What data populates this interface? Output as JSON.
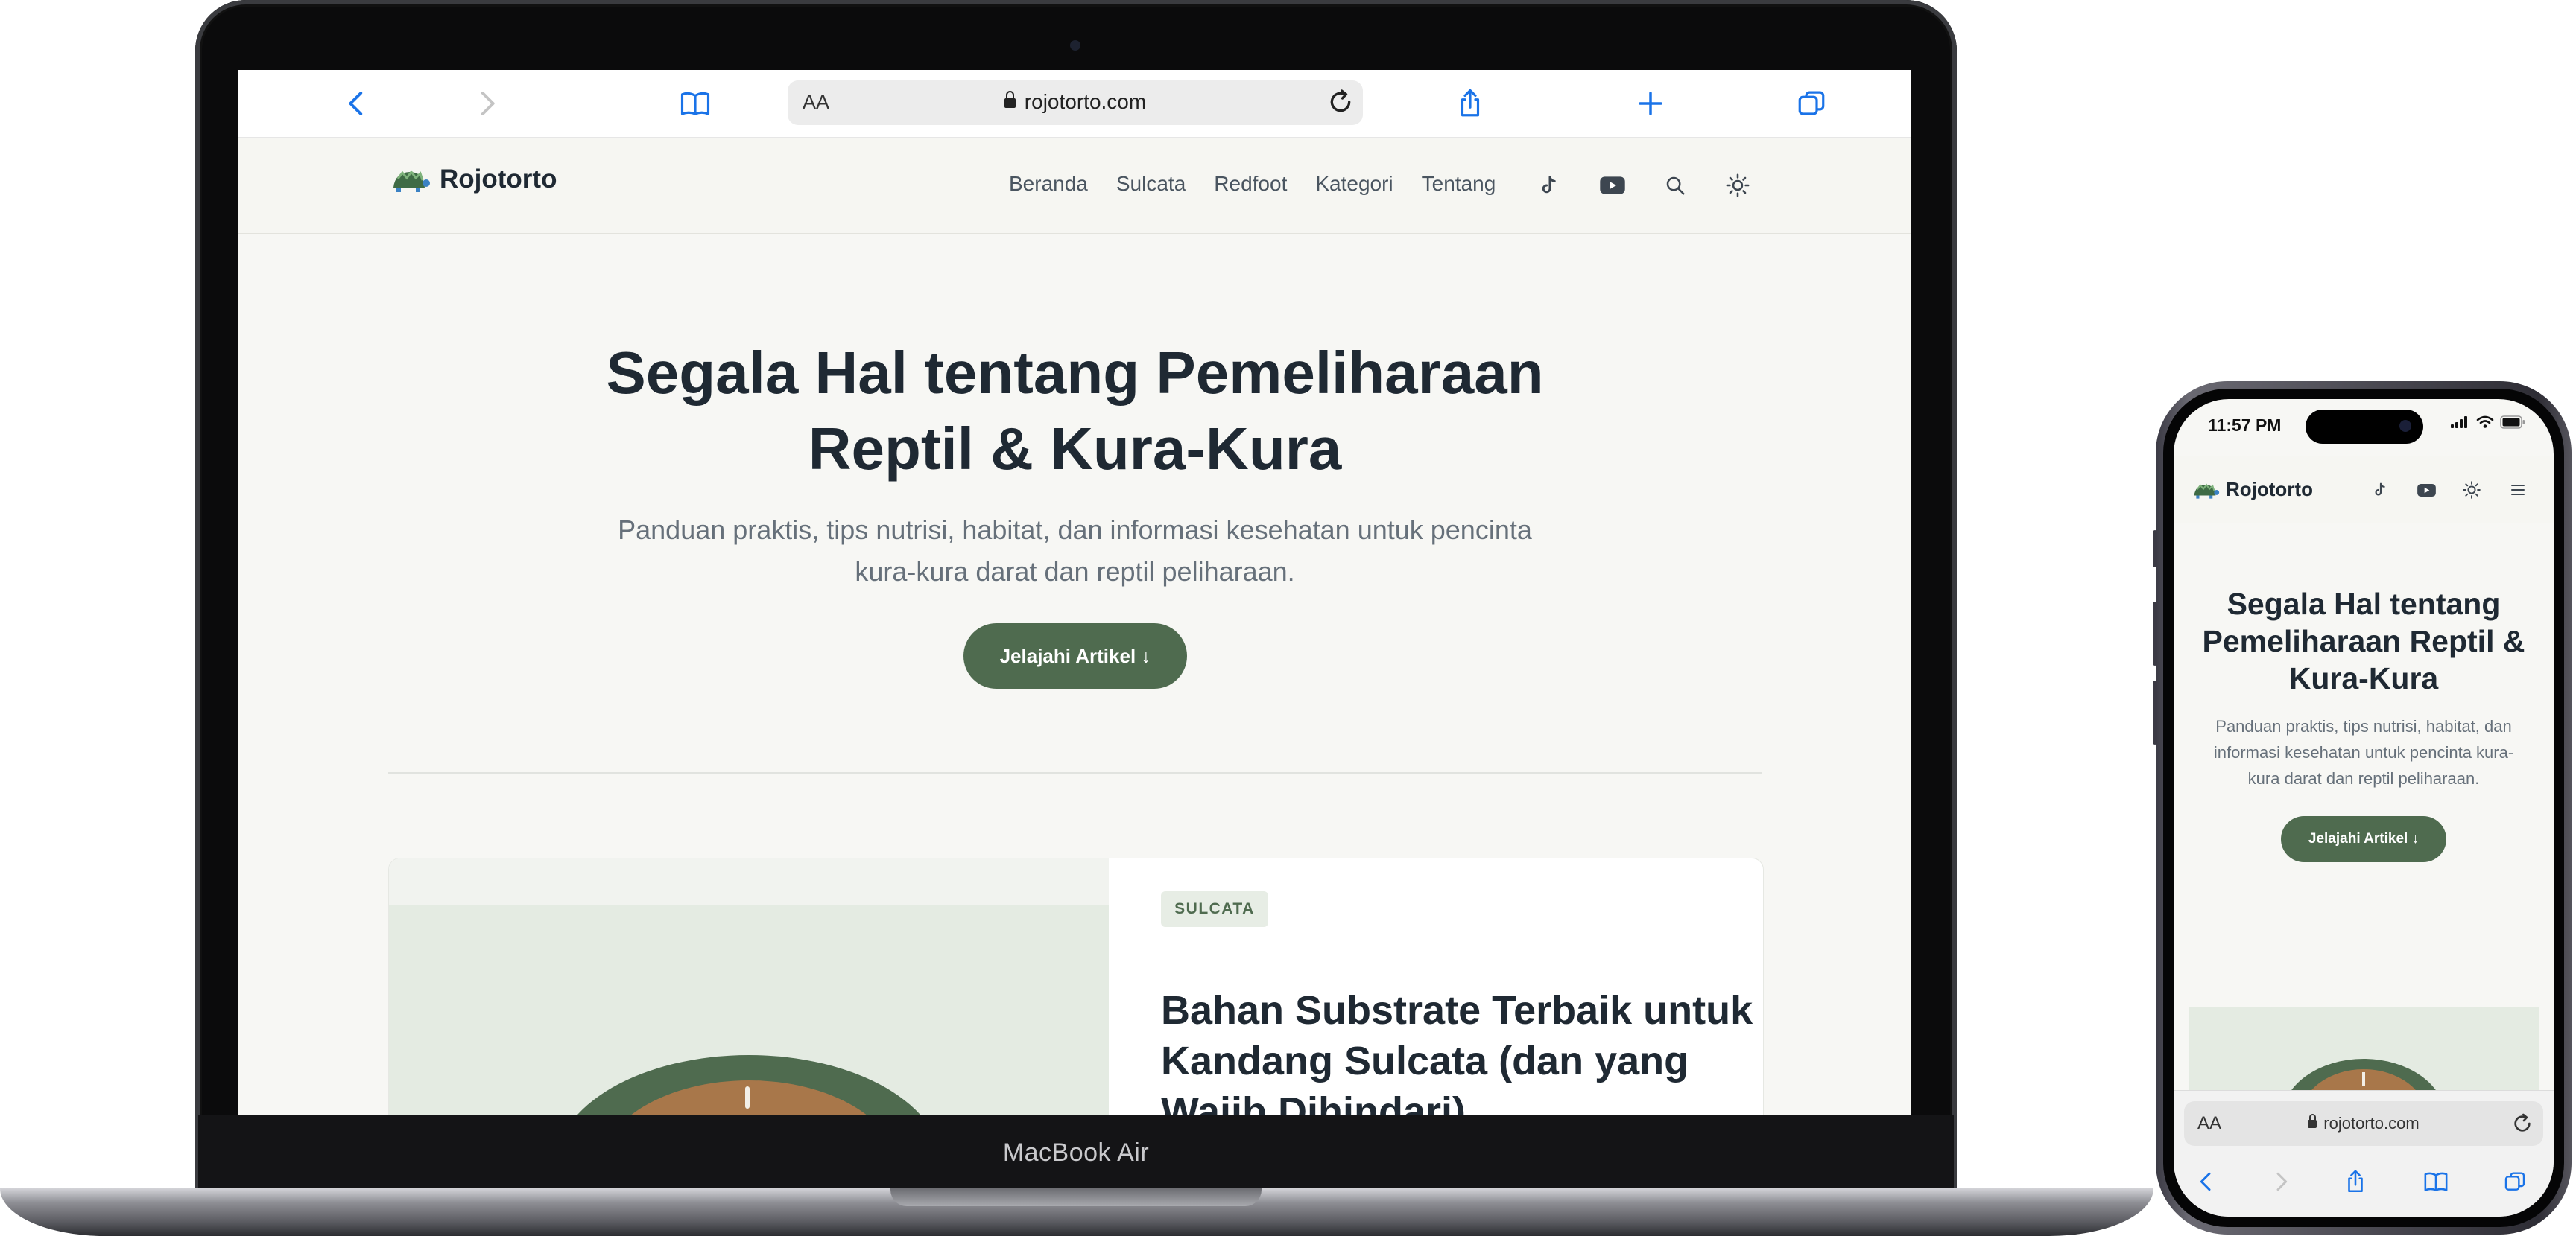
{
  "laptop": {
    "brand_label": "MacBook Air",
    "browser": {
      "text_size_label": "AA",
      "address": "rojotorto.com"
    },
    "site": {
      "logo_name": "Rojotorto",
      "nav": [
        "Beranda",
        "Sulcata",
        "Redfoot",
        "Kategori",
        "Tentang"
      ],
      "hero": {
        "title_line1": "Segala Hal tentang Pemeliharaan",
        "title_line2": "Reptil & Kura-Kura",
        "subtitle_line1": "Panduan praktis, tips nutrisi, habitat, dan informasi kesehatan untuk pencinta",
        "subtitle_line2": "kura-kura darat dan reptil peliharaan.",
        "cta_label": "Jelajahi Artikel ↓"
      },
      "featured_article": {
        "category": "SULCATA",
        "title_line1": "Bahan Substrate Terbaik untuk",
        "title_line2": "Kandang Sulcata (dan yang",
        "title_line3": "Wajib Dihindari)"
      }
    }
  },
  "phone": {
    "status_time": "11:57 PM",
    "site": {
      "logo_name": "Rojotorto",
      "hero": {
        "title_line1": "Segala Hal tentang",
        "title_line2": "Pemeliharaan Reptil &",
        "title_line3": "Kura-Kura",
        "subtitle_line1": "Panduan praktis, tips nutrisi, habitat, dan",
        "subtitle_line2": "informasi kesehatan untuk pencinta kura-",
        "subtitle_line3": "kura darat dan reptil peliharaan.",
        "cta_label": "Jelajahi Artikel ↓"
      }
    },
    "browser": {
      "text_size_label": "AA",
      "address": "rojotorto.com"
    }
  },
  "colors": {
    "accent_green": "#4f6b4f",
    "safari_blue": "#1a73e8",
    "page_background": "#f7f7f4"
  }
}
